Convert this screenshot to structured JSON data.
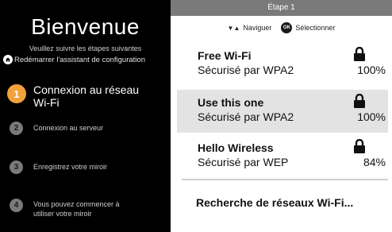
{
  "left": {
    "title": "Bienvenue",
    "intro": "Veuillez suivre les étapes suivantes",
    "restart_label": "Redémarrer l'assistant de configuration",
    "steps": [
      {
        "number": "1",
        "line1": "Connexion au réseau",
        "line2": "Wi-Fi",
        "active": true
      },
      {
        "number": "2",
        "line1": "Connexion au serveur",
        "line2": "",
        "active": false
      },
      {
        "number": "3",
        "line1": "Enregistrez votre miroir",
        "line2": "",
        "active": false
      },
      {
        "number": "4",
        "line1": "Vous pouvez commencer à",
        "line2": "utiliser votre miroir",
        "active": false
      }
    ],
    "active_color": "#f2a23a"
  },
  "right": {
    "header": "Étape 1",
    "nav_arrows": "▼▲",
    "nav_label": "Naviguer",
    "ok_label": "OK",
    "select_label": "Sélectionner",
    "networks": [
      {
        "name": "Free Wi-Fi",
        "security": "Sécurisé par WPA2",
        "signal": "100%",
        "icon": "lock-icon",
        "selected": false
      },
      {
        "name": "Use this one",
        "security": "Sécurisé par WPA2",
        "signal": "100%",
        "icon": "lock-icon",
        "selected": true
      },
      {
        "name": "Hello Wireless",
        "security": "Sécurisé par WEP",
        "signal": "84%",
        "icon": "lock-icon",
        "selected": false
      }
    ],
    "search_label": "Recherche de réseaux Wi-Fi..."
  }
}
